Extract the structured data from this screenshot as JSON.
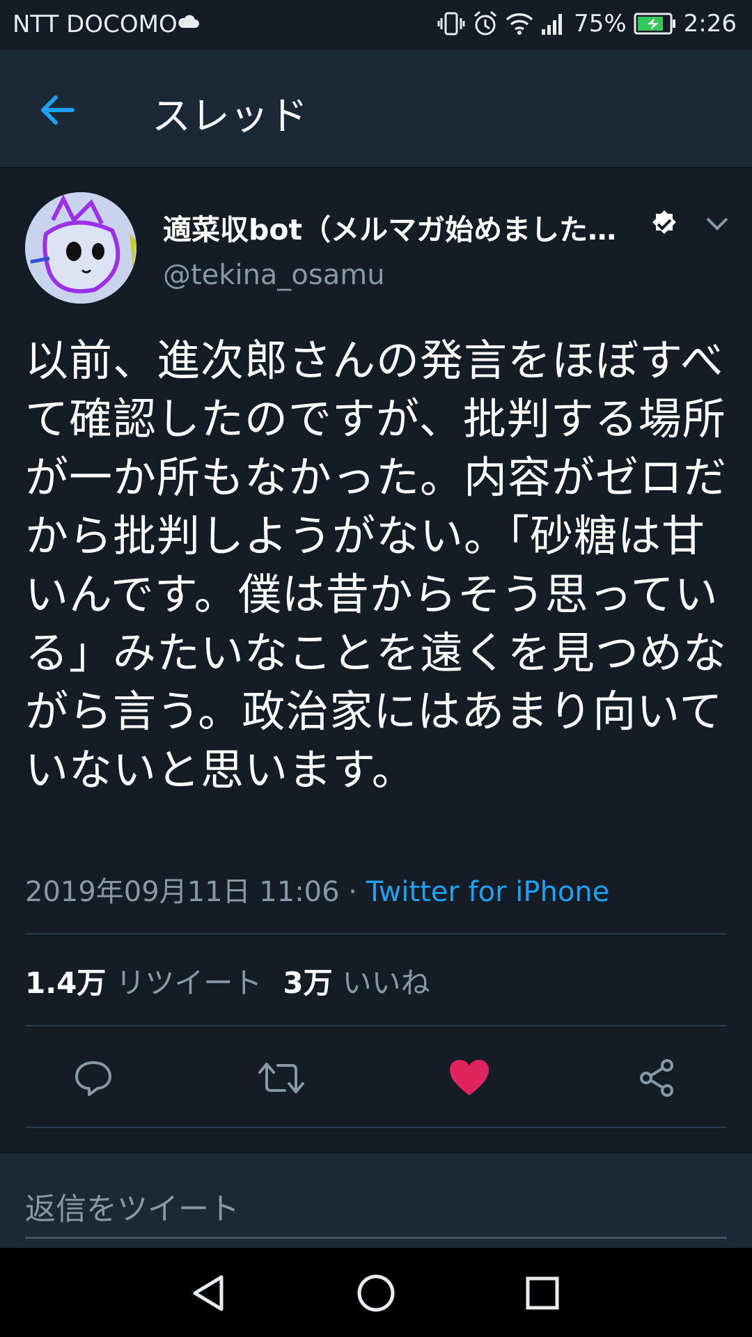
{
  "status_bar": {
    "carrier": "NTT DOCOMO",
    "battery": "75%",
    "time": "2:26",
    "icons": [
      "cloud-icon",
      "vibrate-icon",
      "alarm-icon",
      "wifi-icon",
      "signal-icon",
      "battery-charging-icon"
    ],
    "battery_color": "#34c759"
  },
  "app_bar": {
    "title": "スレッド",
    "back_icon": "arrow-left-icon",
    "accent": "#1da1f2"
  },
  "tweet": {
    "display_name": "適菜収bot（メルマガ始めました…",
    "handle": "@tekina_osamu",
    "verified": true,
    "text": "以前、進次郎さんの発言をほぼすべて確認したのですが、批判する場所が一か所もなかった。内容がゼロだから批判しようがない。「砂糖は甘いんです。僕は昔からそう思っている」みたいなことを遠くを見つめながら言う。政治家にはあまり向いていないと思います。",
    "timestamp": "2019年09月11日 11:06",
    "separator": " · ",
    "source": "Twitter for iPhone",
    "retweets_count": "1.4万",
    "retweets_label": "リツイート",
    "likes_count": "3万",
    "likes_label": "いいね",
    "liked": true,
    "like_color": "#e0245e",
    "action_icons": [
      "reply-icon",
      "retweet-icon",
      "like-heart-icon",
      "share-icon"
    ]
  },
  "reply": {
    "placeholder": "返信をツイート"
  },
  "nav_bar": {
    "icons": [
      "back-triangle-icon",
      "home-circle-icon",
      "recents-square-icon"
    ]
  }
}
